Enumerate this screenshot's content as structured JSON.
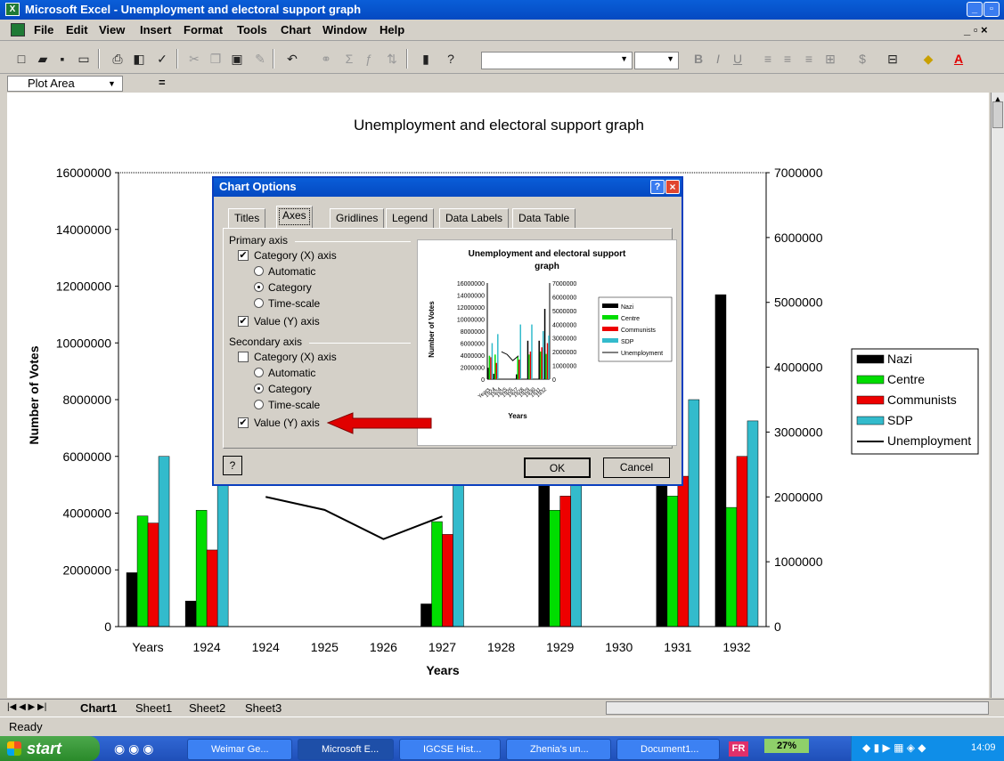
{
  "window": {
    "title": "Microsoft Excel - Unemployment and electoral support graph",
    "app_icon": "excel-icon"
  },
  "menubar": {
    "items": [
      "File",
      "Edit",
      "View",
      "Insert",
      "Format",
      "Tools",
      "Chart",
      "Window",
      "Help"
    ]
  },
  "toolbar": {
    "font_size_bold": "B",
    "font_italic": "I",
    "font_underline": "U"
  },
  "namebox": {
    "value": "Plot Area",
    "equals": "="
  },
  "chart_data": {
    "type": "bar",
    "title": "Unemployment and electoral support graph",
    "xlabel": "Years",
    "ylabel": "Number of Votes",
    "categories": [
      "Years",
      "1924",
      "1924",
      "1925",
      "1926",
      "1927",
      "1928",
      "1929",
      "1930",
      "1931",
      "1932"
    ],
    "ylim": [
      0,
      16000000
    ],
    "y2lim": [
      0,
      7000000
    ],
    "yticks": [
      "0",
      "2000000",
      "4000000",
      "6000000",
      "8000000",
      "10000000",
      "12000000",
      "14000000",
      "16000000"
    ],
    "y2ticks": [
      "0",
      "1000000",
      "2000000",
      "3000000",
      "4000000",
      "5000000",
      "6000000",
      "7000000"
    ],
    "series": [
      {
        "name": "Nazi",
        "color": "#000000",
        "values": [
          1900000,
          900000,
          null,
          null,
          null,
          800000,
          null,
          6400000,
          null,
          6400000,
          11700000
        ]
      },
      {
        "name": "Centre",
        "color": "#00dd00",
        "values": [
          3900000,
          4100000,
          null,
          null,
          null,
          3700000,
          null,
          4100000,
          null,
          4600000,
          4200000
        ]
      },
      {
        "name": "Communists",
        "color": "#ee0000",
        "values": [
          3650000,
          2700000,
          null,
          null,
          null,
          3250000,
          null,
          4600000,
          null,
          5300000,
          6000000
        ]
      },
      {
        "name": "SDP",
        "color": "#33bbcc",
        "values": [
          6000000,
          7500000,
          null,
          null,
          null,
          9100000,
          null,
          9100000,
          null,
          8000000,
          7250000
        ]
      }
    ],
    "line_series": {
      "name": "Unemployment",
      "axis": "secondary",
      "values": [
        null,
        null,
        2000000,
        1800000,
        1350000,
        1700000,
        null,
        null,
        null,
        null,
        null
      ]
    },
    "legend": {
      "placement": "right",
      "items": [
        "Nazi",
        "Centre",
        "Communists",
        "SDP",
        "Unemployment"
      ]
    }
  },
  "dialog": {
    "title": "Chart Options",
    "tabs": [
      "Titles",
      "Axes",
      "Gridlines",
      "Legend",
      "Data Labels",
      "Data Table"
    ],
    "active_tab": "Axes",
    "primary_axis": {
      "label": "Primary axis",
      "category_x": "Category (X) axis",
      "category_x_checked": true,
      "options": [
        "Automatic",
        "Category",
        "Time-scale"
      ],
      "selected": "Category",
      "value_y": "Value (Y) axis",
      "value_y_checked": true
    },
    "secondary_axis": {
      "label": "Secondary axis",
      "category_x": "Category (X) axis",
      "category_x_checked": false,
      "options": [
        "Automatic",
        "Category",
        "Time-scale"
      ],
      "selected": "Category",
      "value_y": "Value (Y) axis",
      "value_y_checked": true
    },
    "preview": {
      "title_line1": "Unemployment and electoral support",
      "title_line2": "graph",
      "ylabel": "Number of Votes",
      "xlabel": "Years",
      "yticks": [
        "16000000",
        "14000000",
        "12000000",
        "10000000",
        "8000000",
        "6000000",
        "4000000",
        "2000000",
        "0"
      ],
      "y2ticks": [
        "7000000",
        "6000000",
        "5000000",
        "4000000",
        "3000000",
        "2000000",
        "1000000",
        "0"
      ],
      "legend": [
        "Nazi",
        "Centre",
        "Communists",
        "SDP",
        "Unemployment"
      ]
    },
    "ok_label": "OK",
    "cancel_label": "Cancel",
    "help_label": "?"
  },
  "sheet_tabs": {
    "active": "Chart1",
    "items": [
      "Chart1",
      "Sheet1",
      "Sheet2",
      "Sheet3"
    ]
  },
  "status": {
    "text": "Ready"
  },
  "taskbar": {
    "start": "start",
    "tasks": [
      "Weimar Ge...",
      "Microsoft E...",
      "IGCSE Hist...",
      "Zhenia's un...",
      "Document1..."
    ],
    "lang": "FR",
    "zoom": "27%",
    "clock": "14:09"
  }
}
